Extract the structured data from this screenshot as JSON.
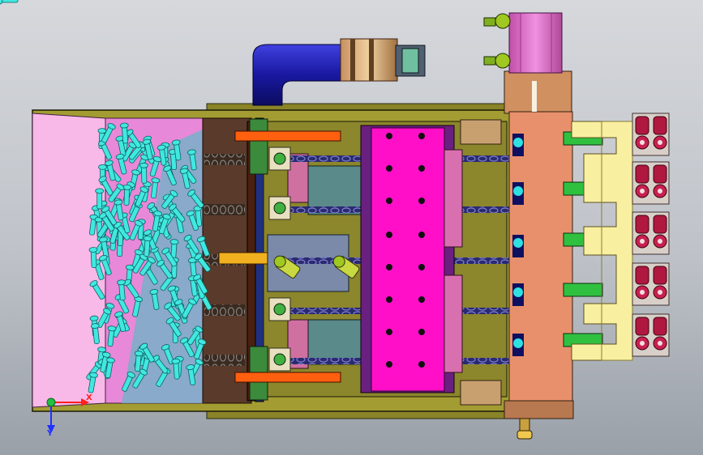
{
  "viewport": {
    "background_top": "#d6d8dc",
    "background_bottom": "#9aa0a8"
  },
  "triad": {
    "x_label": "X",
    "y_label": "Y",
    "x_color": "#ff2020",
    "y_color": "#2030ff",
    "origin_color": "#20c040"
  },
  "colors": {
    "frame_olive": "#a39c32",
    "plate_magenta": "#ff10c8",
    "parts_cyan": "#40e8e0",
    "salmon_block": "#e8906c",
    "cylinder_pink": "#e070c8",
    "pipe_blue": "#2020c0",
    "fitting_green": "#9fc820",
    "fitting_crimson": "#b01840",
    "yellow_bracket": "#f8f0a0",
    "rod_orange": "#ff6010",
    "hopper_pink": "#f8b8e8"
  }
}
